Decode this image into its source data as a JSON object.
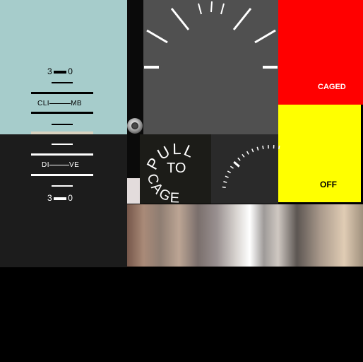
{
  "attitude_indicator": {
    "pitch_top": "3—0",
    "climb_left": "CLI",
    "climb_right": "MB",
    "dive_left": "DI",
    "dive_right": "VE",
    "pitch_bottom": "3—0",
    "sky_color": "#a6cccb",
    "ground_color": "#1c1c1c"
  },
  "status_flags": {
    "caged_label": "CAGED",
    "caged_color": "#ff0000",
    "off_label": "OFF",
    "off_color": "#ffff00"
  },
  "cage_knob": {
    "ring_text": "PULL",
    "center_text": "TO",
    "bottom_text": "CAGE"
  },
  "icons": {
    "screw": "screw-icon",
    "bank_scale": "bank-scale",
    "pitch_scale": "dial-tick-scale"
  }
}
